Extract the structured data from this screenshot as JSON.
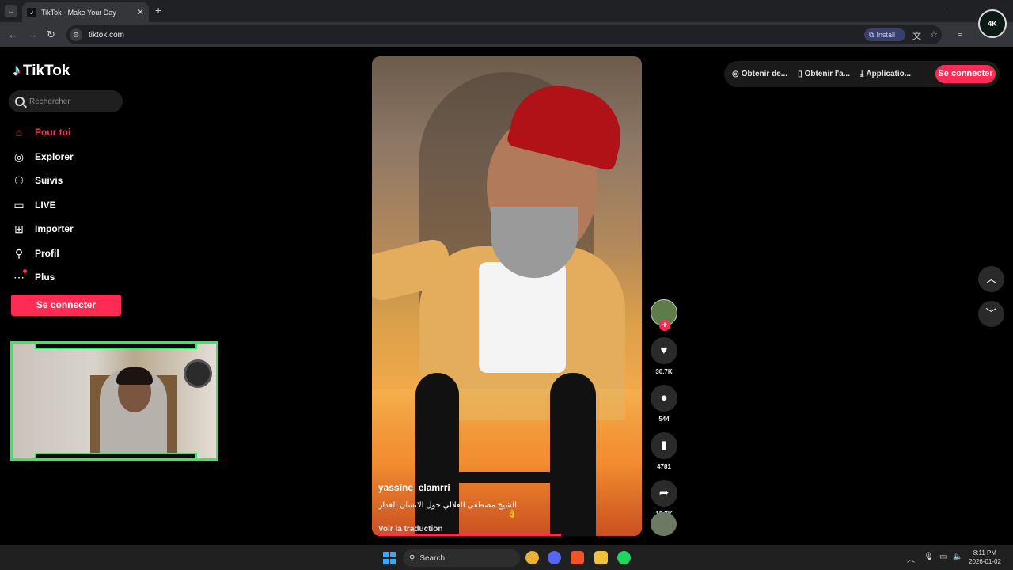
{
  "browser": {
    "tab_title": "TikTok - Make Your Day",
    "url": "tiktok.com",
    "install_label": "Install",
    "profile_badge": "4K"
  },
  "tiktok": {
    "logo_text": "TikTok",
    "search_placeholder": "Rechercher",
    "nav": [
      {
        "label": "Pour toi",
        "icon": "home-icon",
        "active": true
      },
      {
        "label": "Explorer",
        "icon": "compass-icon"
      },
      {
        "label": "Suivis",
        "icon": "following-icon"
      },
      {
        "label": "LIVE",
        "icon": "live-icon"
      },
      {
        "label": "Importer",
        "icon": "upload-icon"
      },
      {
        "label": "Profil",
        "icon": "profile-icon"
      },
      {
        "label": "Plus",
        "icon": "more-icon"
      }
    ],
    "login_label": "Se connecter",
    "top_links": [
      "Obtenir de...",
      "Obtenir l'a...",
      "Applicatio..."
    ],
    "top_login": "Se connecter",
    "video": {
      "author": "yassine_elamrri",
      "description": "الشيخ مصطفى العلالي حول الانسان الغدار 👌",
      "translate": "Voir la traduction",
      "progress": 0.7
    },
    "actions": {
      "likes": "30.7K",
      "comments": "544",
      "saves": "4781",
      "shares": "18.7K"
    },
    "accent": "#fe2c55"
  },
  "taskbar": {
    "search_label": "Search",
    "time": "8:11 PM",
    "date": "2026-01-02"
  }
}
